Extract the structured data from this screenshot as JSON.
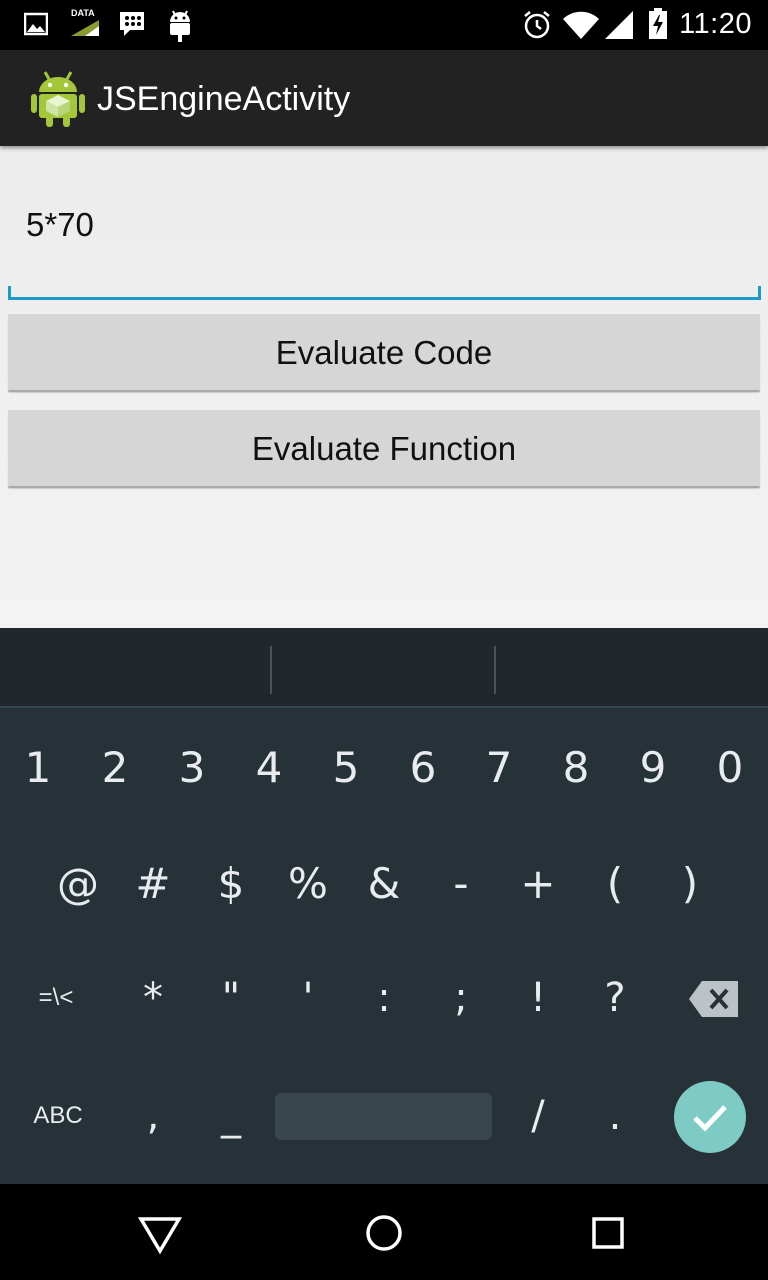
{
  "status_bar": {
    "time": "11:20",
    "data_label": "DATA",
    "icons": [
      "image-icon",
      "data-icon",
      "blackberry-icon",
      "android-icon",
      "alarm-icon",
      "wifi-icon",
      "signal-icon",
      "battery-charging-icon"
    ]
  },
  "action_bar": {
    "title": "JSEngineActivity",
    "icon": "android-app-icon"
  },
  "main": {
    "code_input_value": "5*70",
    "evaluate_code_label": "Evaluate Code",
    "evaluate_function_label": "Evaluate Function"
  },
  "keyboard": {
    "row1": [
      "1",
      "2",
      "3",
      "4",
      "5",
      "6",
      "7",
      "8",
      "9",
      "0"
    ],
    "row2": [
      "@",
      "#",
      "$",
      "%",
      "&",
      "-",
      "+",
      "(",
      ")"
    ],
    "row3": [
      "=\\<",
      "*",
      "\"",
      "'",
      ":",
      ";",
      "!",
      "?"
    ],
    "row4": [
      "ABC",
      ",",
      "_",
      "/",
      "."
    ],
    "accent_color": "#7ecbc6"
  },
  "nav_bar": {
    "icons": [
      "back-icon",
      "home-icon",
      "recents-icon"
    ]
  }
}
